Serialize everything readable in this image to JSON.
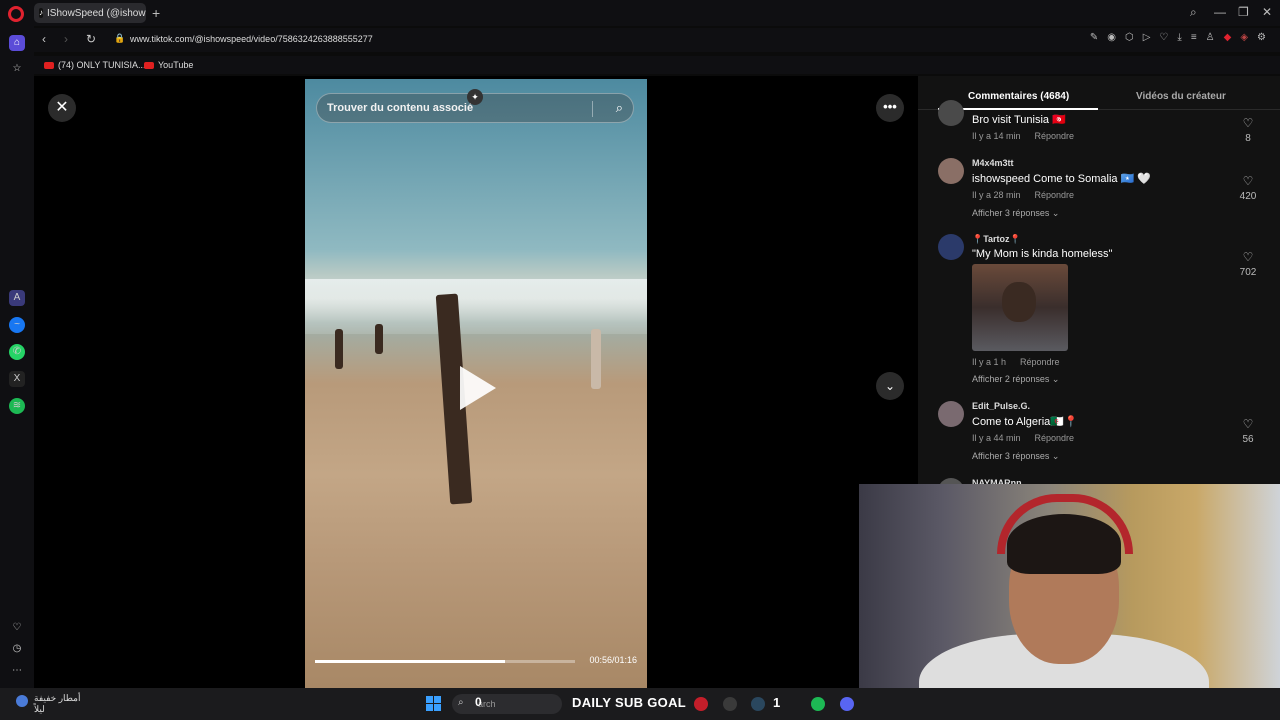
{
  "browser": {
    "tab_title": "IShowSpeed (@ishow",
    "url": "www.tiktok.com/@ishowspeed/video/7586324263888555277",
    "bookmarks": [
      "(74) ONLY TUNISIA...",
      "YouTube"
    ]
  },
  "video": {
    "search_placeholder": "Trouver du contenu associé",
    "time": "00:56/01:16",
    "progress": 0.73
  },
  "comments_panel": {
    "tabs": [
      "Commentaires (4684)",
      "Vidéos du créateur"
    ],
    "reply_label": "Répondre",
    "comments": [
      {
        "user": "",
        "text": "Bro visit Tunisia 🇹🇳",
        "time": "Il y a 14 min",
        "likes": "8",
        "replies": ""
      },
      {
        "user": "M4x4m3tt",
        "text": "ishowspeed Come to Somalia 🇸🇴 🤍",
        "time": "Il y a 28 min",
        "likes": "420",
        "replies": "Afficher 3 réponses"
      },
      {
        "user": "📍Tartoz📍",
        "text": "\"My Mom is kinda homeless\"",
        "time": "Il y a 1 h",
        "likes": "702",
        "replies": "Afficher 2 réponses"
      },
      {
        "user": "Edit_Pulse.G.",
        "text": "Come to Algeria🇩🇿📍",
        "time": "Il y a 44 min",
        "likes": "56",
        "replies": "Afficher 3 réponses"
      },
      {
        "user": "NAYMARnn",
        "text": "",
        "time": "",
        "likes": "",
        "replies": ""
      }
    ]
  },
  "taskbar": {
    "weather_line1": "أمطار خفيفة",
    "weather_line2": "ليلاً",
    "search_text": "arch",
    "counter_left": "0",
    "goal_label": "DAILY SUB GOAL",
    "counter_right": "1"
  }
}
